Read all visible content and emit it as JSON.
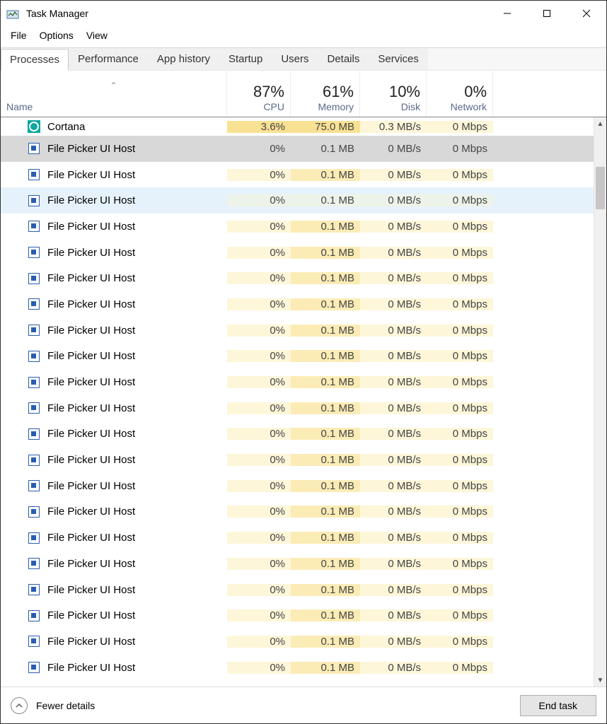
{
  "window": {
    "title": "Task Manager"
  },
  "menu": {
    "file": "File",
    "options": "Options",
    "view": "View"
  },
  "tabs": {
    "processes": "Processes",
    "performance": "Performance",
    "apphistory": "App history",
    "startup": "Startup",
    "users": "Users",
    "details": "Details",
    "services": "Services"
  },
  "headers": {
    "name": "Name",
    "cpu_pct": "87%",
    "cpu_lbl": "CPU",
    "mem_pct": "61%",
    "mem_lbl": "Memory",
    "disk_pct": "10%",
    "disk_lbl": "Disk",
    "net_pct": "0%",
    "net_lbl": "Network"
  },
  "rows": [
    {
      "name": "Cortana",
      "cpu": "3.6%",
      "mem": "75.0 MB",
      "disk": "0.3 MB/s",
      "net": "0 Mbps",
      "icon": "cortana",
      "partial": true
    },
    {
      "name": "File Picker UI Host",
      "cpu": "0%",
      "mem": "0.1 MB",
      "disk": "0 MB/s",
      "net": "0 Mbps",
      "icon": "app",
      "selected": true
    },
    {
      "name": "File Picker UI Host",
      "cpu": "0%",
      "mem": "0.1 MB",
      "disk": "0 MB/s",
      "net": "0 Mbps",
      "icon": "app"
    },
    {
      "name": "File Picker UI Host",
      "cpu": "0%",
      "mem": "0.1 MB",
      "disk": "0 MB/s",
      "net": "0 Mbps",
      "icon": "app",
      "hovered": true
    },
    {
      "name": "File Picker UI Host",
      "cpu": "0%",
      "mem": "0.1 MB",
      "disk": "0 MB/s",
      "net": "0 Mbps",
      "icon": "app"
    },
    {
      "name": "File Picker UI Host",
      "cpu": "0%",
      "mem": "0.1 MB",
      "disk": "0 MB/s",
      "net": "0 Mbps",
      "icon": "app"
    },
    {
      "name": "File Picker UI Host",
      "cpu": "0%",
      "mem": "0.1 MB",
      "disk": "0 MB/s",
      "net": "0 Mbps",
      "icon": "app"
    },
    {
      "name": "File Picker UI Host",
      "cpu": "0%",
      "mem": "0.1 MB",
      "disk": "0 MB/s",
      "net": "0 Mbps",
      "icon": "app"
    },
    {
      "name": "File Picker UI Host",
      "cpu": "0%",
      "mem": "0.1 MB",
      "disk": "0 MB/s",
      "net": "0 Mbps",
      "icon": "app"
    },
    {
      "name": "File Picker UI Host",
      "cpu": "0%",
      "mem": "0.1 MB",
      "disk": "0 MB/s",
      "net": "0 Mbps",
      "icon": "app"
    },
    {
      "name": "File Picker UI Host",
      "cpu": "0%",
      "mem": "0.1 MB",
      "disk": "0 MB/s",
      "net": "0 Mbps",
      "icon": "app"
    },
    {
      "name": "File Picker UI Host",
      "cpu": "0%",
      "mem": "0.1 MB",
      "disk": "0 MB/s",
      "net": "0 Mbps",
      "icon": "app"
    },
    {
      "name": "File Picker UI Host",
      "cpu": "0%",
      "mem": "0.1 MB",
      "disk": "0 MB/s",
      "net": "0 Mbps",
      "icon": "app"
    },
    {
      "name": "File Picker UI Host",
      "cpu": "0%",
      "mem": "0.1 MB",
      "disk": "0 MB/s",
      "net": "0 Mbps",
      "icon": "app"
    },
    {
      "name": "File Picker UI Host",
      "cpu": "0%",
      "mem": "0.1 MB",
      "disk": "0 MB/s",
      "net": "0 Mbps",
      "icon": "app"
    },
    {
      "name": "File Picker UI Host",
      "cpu": "0%",
      "mem": "0.1 MB",
      "disk": "0 MB/s",
      "net": "0 Mbps",
      "icon": "app"
    },
    {
      "name": "File Picker UI Host",
      "cpu": "0%",
      "mem": "0.1 MB",
      "disk": "0 MB/s",
      "net": "0 Mbps",
      "icon": "app"
    },
    {
      "name": "File Picker UI Host",
      "cpu": "0%",
      "mem": "0.1 MB",
      "disk": "0 MB/s",
      "net": "0 Mbps",
      "icon": "app"
    },
    {
      "name": "File Picker UI Host",
      "cpu": "0%",
      "mem": "0.1 MB",
      "disk": "0 MB/s",
      "net": "0 Mbps",
      "icon": "app"
    },
    {
      "name": "File Picker UI Host",
      "cpu": "0%",
      "mem": "0.1 MB",
      "disk": "0 MB/s",
      "net": "0 Mbps",
      "icon": "app"
    },
    {
      "name": "File Picker UI Host",
      "cpu": "0%",
      "mem": "0.1 MB",
      "disk": "0 MB/s",
      "net": "0 Mbps",
      "icon": "app"
    },
    {
      "name": "File Picker UI Host",
      "cpu": "0%",
      "mem": "0.1 MB",
      "disk": "0 MB/s",
      "net": "0 Mbps",
      "icon": "app"
    }
  ],
  "bottom": {
    "fewer": "Fewer details",
    "end": "End task"
  }
}
